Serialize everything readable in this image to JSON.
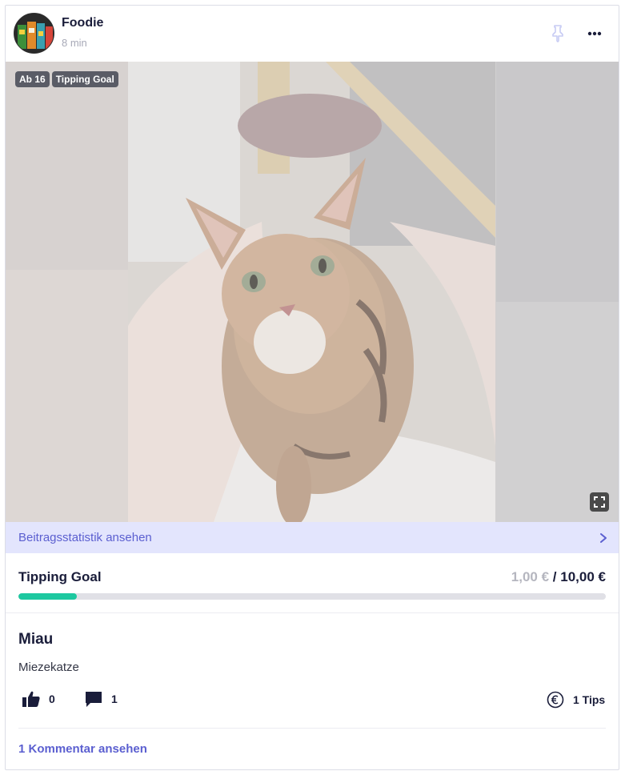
{
  "post": {
    "username": "Foodie",
    "time": "8 min",
    "badges": [
      "Ab 16",
      "Tipping Goal"
    ],
    "title": "Miau",
    "description": "Miezekatze"
  },
  "stats_link": "Beitragsstatistik ansehen",
  "tipping_goal": {
    "label": "Tipping Goal",
    "current": "1,00 €",
    "separator": "/",
    "target": "10,00 €",
    "progress_fraction": 0.1,
    "bar_color": "#1dc8a0"
  },
  "actions": {
    "likes": "0",
    "comments": "1",
    "tips": "1 Tips"
  },
  "view_comments": "1 Kommentar ansehen",
  "colors": {
    "accent": "#5b5fd0",
    "stats_bg": "#e3e5fd",
    "text_dark": "#1a1d3a"
  },
  "icons": [
    "pin-icon",
    "more-icon",
    "fullscreen-icon",
    "chevron-right-icon",
    "thumbs-up-icon",
    "comment-icon",
    "euro-icon"
  ]
}
